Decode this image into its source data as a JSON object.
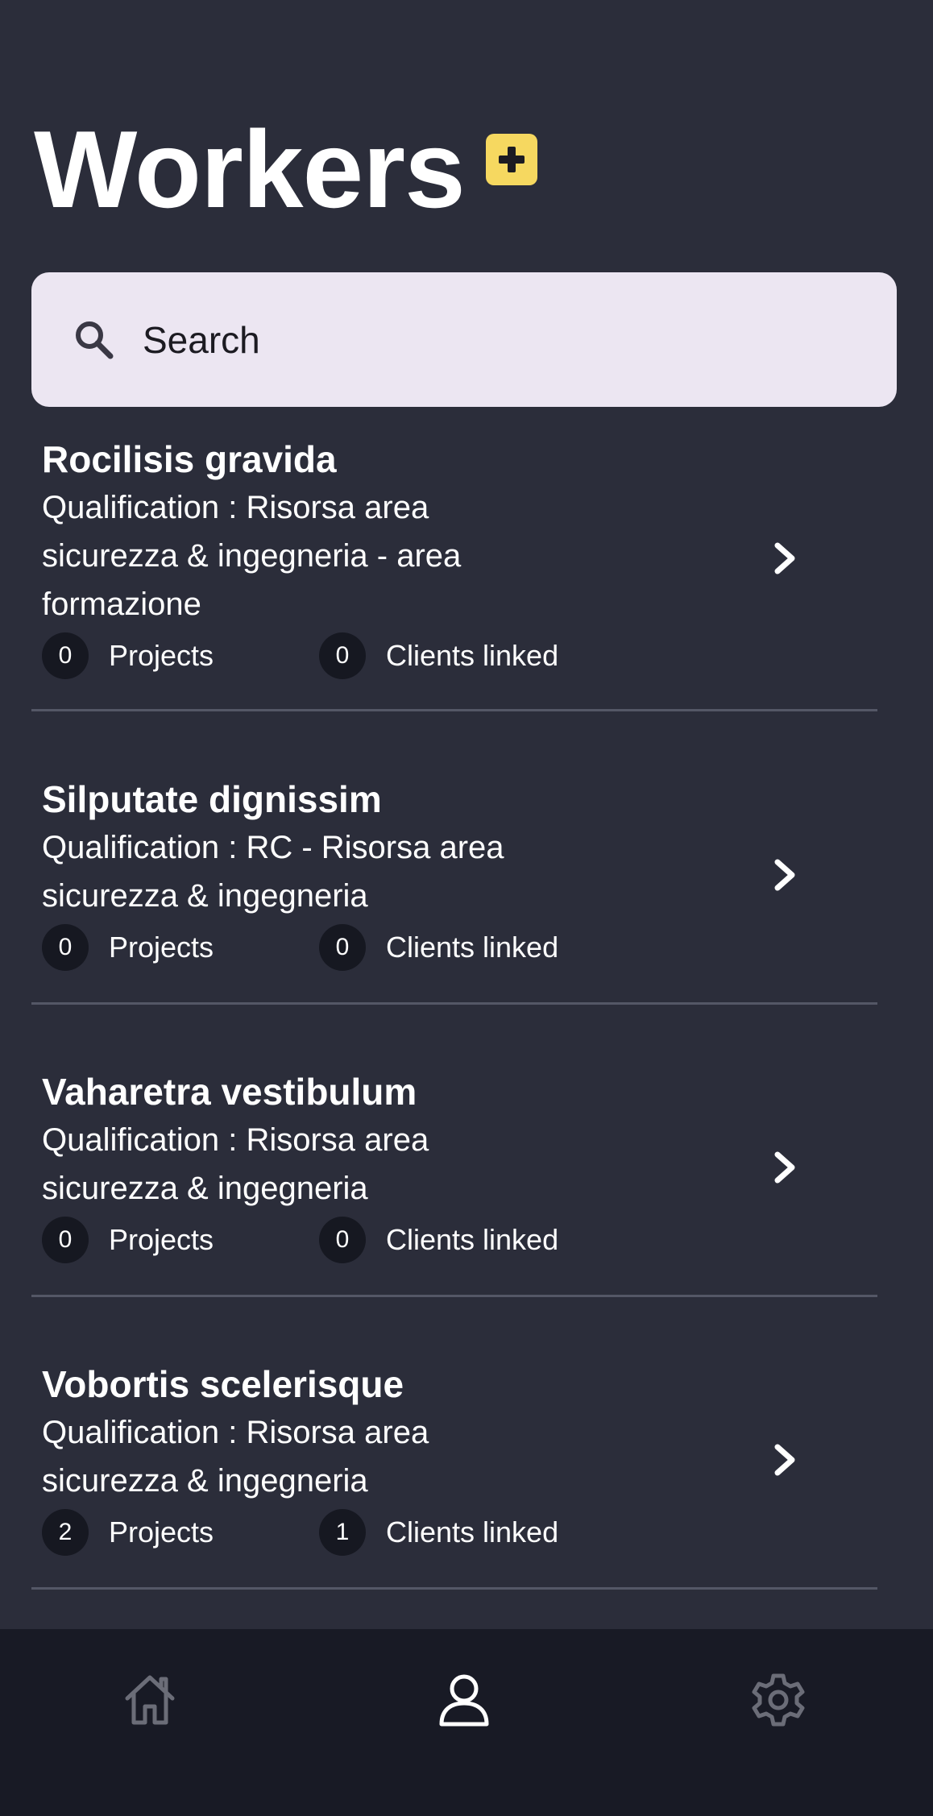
{
  "header": {
    "title": "Workers",
    "add_icon": "plus-icon",
    "accent_color": "#f6d860"
  },
  "search": {
    "placeholder": "Search",
    "icon": "search-icon"
  },
  "workers": [
    {
      "name": "Rocilisis gravida",
      "qualification": "Qualification : Risorsa area sicurezza & ingegneria - area formazione",
      "projects_count": "0",
      "projects_label": "Projects",
      "clients_count": "0",
      "clients_label": "Clients linked"
    },
    {
      "name": "Silputate dignissim",
      "qualification": "Qualification : RC - Risorsa area sicurezza & ingegneria",
      "projects_count": "0",
      "projects_label": "Projects",
      "clients_count": "0",
      "clients_label": "Clients linked"
    },
    {
      "name": "Vaharetra vestibulum",
      "qualification": "Qualification : Risorsa area sicurezza & ingegneria",
      "projects_count": "0",
      "projects_label": "Projects",
      "clients_count": "0",
      "clients_label": "Clients linked"
    },
    {
      "name": "Vobortis scelerisque",
      "qualification": "Qualification : Risorsa area sicurezza & ingegneria",
      "projects_count": "2",
      "projects_label": "Projects",
      "clients_count": "1",
      "clients_label": "Clients linked"
    }
  ],
  "bottom_nav": {
    "items": [
      {
        "icon": "home-icon",
        "active": false
      },
      {
        "icon": "user-icon",
        "active": true
      },
      {
        "icon": "gear-icon",
        "active": false
      }
    ]
  }
}
